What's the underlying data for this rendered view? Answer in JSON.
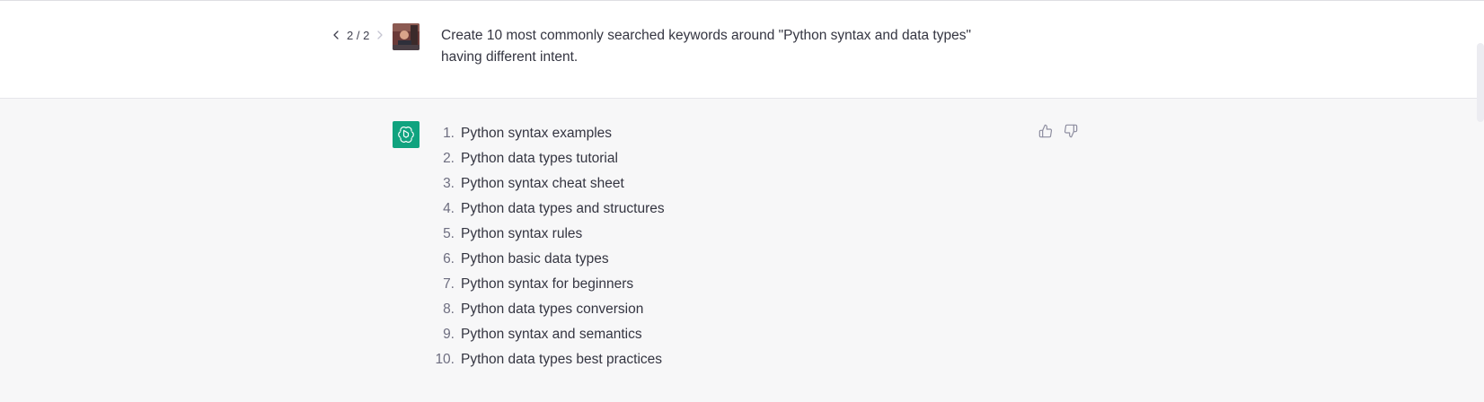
{
  "pager": {
    "label": "2 / 2"
  },
  "user_message": {
    "text": "Create 10 most commonly searched keywords around \"Python syntax and data types\" having different intent."
  },
  "assistant_message": {
    "items": [
      {
        "number": "1.",
        "text": "Python syntax examples"
      },
      {
        "number": "2.",
        "text": "Python data types tutorial"
      },
      {
        "number": "3.",
        "text": "Python syntax cheat sheet"
      },
      {
        "number": "4.",
        "text": "Python data types and structures"
      },
      {
        "number": "5.",
        "text": "Python syntax rules"
      },
      {
        "number": "6.",
        "text": "Python basic data types"
      },
      {
        "number": "7.",
        "text": "Python syntax for beginners"
      },
      {
        "number": "8.",
        "text": "Python data types conversion"
      },
      {
        "number": "9.",
        "text": "Python syntax and semantics"
      },
      {
        "number": "10.",
        "text": "Python data types best practices"
      }
    ]
  },
  "icons": {
    "prev": "chevron-left-icon",
    "next": "chevron-right-icon",
    "thumbs_up": "thumbs-up-icon",
    "thumbs_down": "thumbs-down-icon",
    "assistant_avatar": "openai-logo-icon"
  },
  "colors": {
    "assistant_avatar_bg": "#10a37f",
    "assistant_bg": "#f7f7f8",
    "text": "#343541"
  }
}
